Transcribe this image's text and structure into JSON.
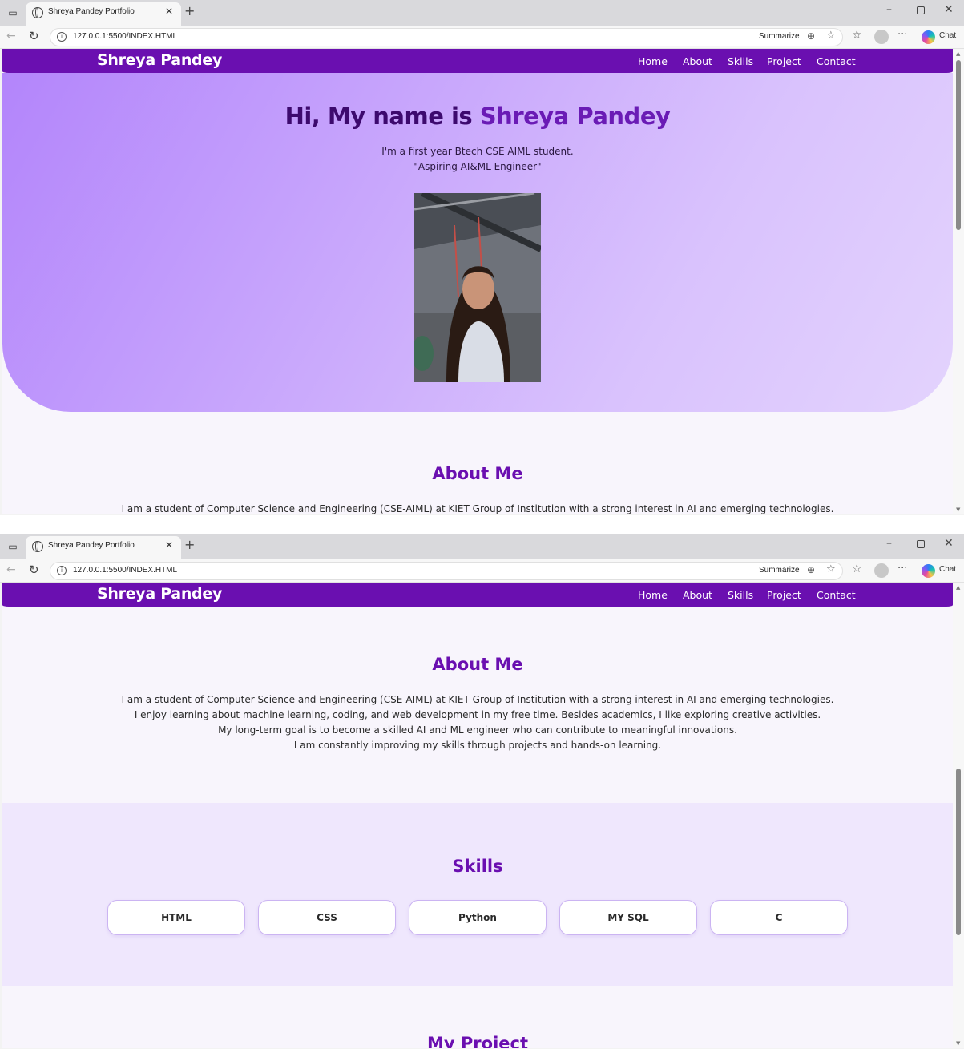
{
  "browser": {
    "tab_title": "Shreya Pandey Portfolio",
    "url": "127.0.0.1:5500/INDEX.HTML",
    "summarize_label": "Summarize",
    "chat_label": "Chat"
  },
  "navbar": {
    "brand": "Shreya Pandey",
    "links": [
      "Home",
      "About",
      "Skills",
      "Project",
      "Contact"
    ]
  },
  "hero": {
    "greeting": "Hi, My name is",
    "name": "Shreya Pandey",
    "line1": "I'm a first year Btech CSE AIML student.",
    "line2": "\"Aspiring AI&ML Engineer\""
  },
  "about": {
    "title": "About Me",
    "lines": [
      "I am a student of Computer Science and Engineering (CSE-AIML) at KIET Group of Institution with a strong interest in AI and emerging technologies.",
      "I enjoy learning about machine learning, coding, and web development in my free time. Besides academics, I like exploring creative activities.",
      "My long-term goal is to become a skilled AI and ML engineer who can contribute to meaningful innovations.",
      "I am constantly improving my skills through projects and hands-on learning."
    ]
  },
  "skills": {
    "title": "Skills",
    "items": [
      "HTML",
      "CSS",
      "Python",
      "MY SQL",
      "C"
    ]
  },
  "projects": {
    "title": "My Project"
  },
  "colors": {
    "nav_bg": "#6a0fb0",
    "accent": "#6a1bb5",
    "hero_start": "#b385fb",
    "hero_end": "#e3d3fd",
    "skills_bg": "#efe7fd"
  }
}
